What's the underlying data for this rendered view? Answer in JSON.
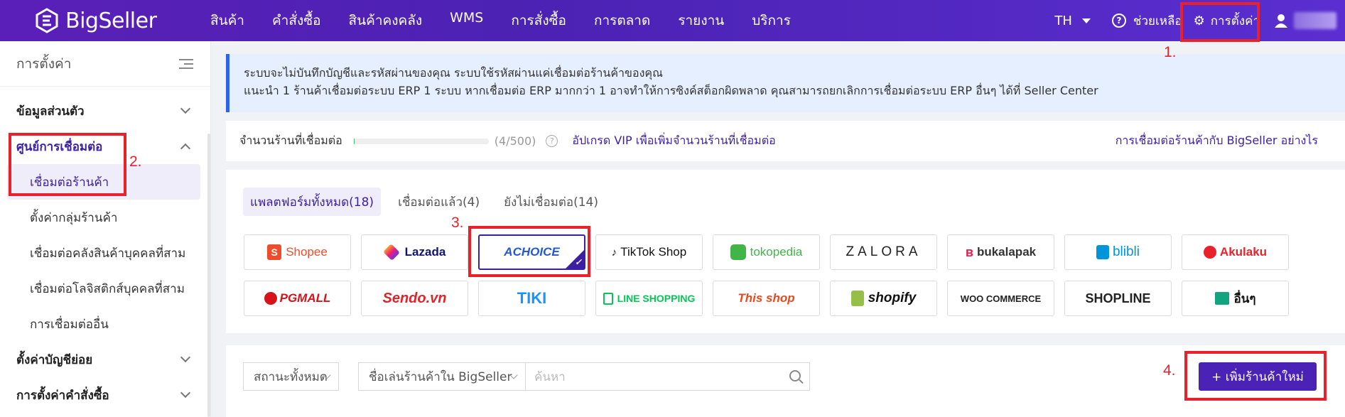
{
  "app": {
    "name": "BigSeller"
  },
  "nav": {
    "items": [
      "สินค้า",
      "คำสั่งซื้อ",
      "สินค้าคงคลัง",
      "WMS",
      "การสั่งซื้อ",
      "การตลาด",
      "รายงาน",
      "บริการ"
    ]
  },
  "header": {
    "lang": "TH",
    "help": "ช่วยเหลือ",
    "settings": "การตั้งค่า"
  },
  "sidebar": {
    "title": "การตั้งค่า",
    "groups": [
      {
        "label": "ข้อมูลส่วนตัว"
      },
      {
        "label": "ศูนย์การเชื่อมต่อ"
      },
      {
        "label": "ตั้งค่าบัญชีย่อย"
      },
      {
        "label": "การตั้งค่าคำสั่งซื้อ"
      }
    ],
    "items": [
      "เชื่อมต่อร้านค้า",
      "ตั้งค่ากลุ่มร้านค้า",
      "เชื่อมต่อคลังสินค้าบุคคลที่สาม",
      "เชื่อมต่อโลจิสติกส์บุคคลที่สาม",
      "การเชื่อมต่ออื่น"
    ]
  },
  "notice": {
    "line1": "ระบบจะไม่บันทึกบัญชีและรหัสผ่านของคุณ ระบบใช้รหัสผ่านแค่เชื่อมต่อร้านค้าของคุณ",
    "line2": "แนะนำ 1 ร้านค้าเชื่อมต่อระบบ ERP 1 ระบบ หากเชื่อมต่อ ERP มากกว่า 1 อาจทำให้การซิงค์สต็อกผิดพลาด คุณสามารถยกเลิกการเชื่อมต่อระบบ ERP อื่นๆ ได้ที่ Seller Center"
  },
  "stores": {
    "label": "จำนวนร้านที่เชื่อมต่อ",
    "connected_fraction": 0.008,
    "count": "(4/500)",
    "upgrade": "อัปเกรด VIP เพื่อเพิ่มจำนวนร้านที่เชื่อมต่อ",
    "howto": "การเชื่อมต่อร้านค้ากับ BigSeller อย่างไร"
  },
  "tabs": [
    "แพลตฟอร์มทั้งหมด(18)",
    "เชื่อมต่อแล้ว(4)",
    "ยังไม่เชื่อมต่อ(14)"
  ],
  "platforms": [
    "Shopee",
    "Lazada",
    "ACHOICE",
    "TikTok Shop",
    "tokopedia",
    "ZALORA",
    "bukalapak",
    "blibli",
    "Akulaku",
    "PGMALL",
    "Sendo.vn",
    "TIKI",
    "LINE SHOPPING",
    "This shop",
    "shopify",
    "WOO COMMERCE",
    "SHOPLINE",
    "อื่นๆ"
  ],
  "filters": {
    "status": "สถานะทั้งหมด",
    "nickname": "ชื่อเล่นร้านค้าใน BigSeller",
    "search_placeholder": "ค้นหา",
    "add_button": "+ เพิ่มร้านค้าใหม่"
  },
  "annotations": [
    "1.",
    "2.",
    "3.",
    "4."
  ]
}
